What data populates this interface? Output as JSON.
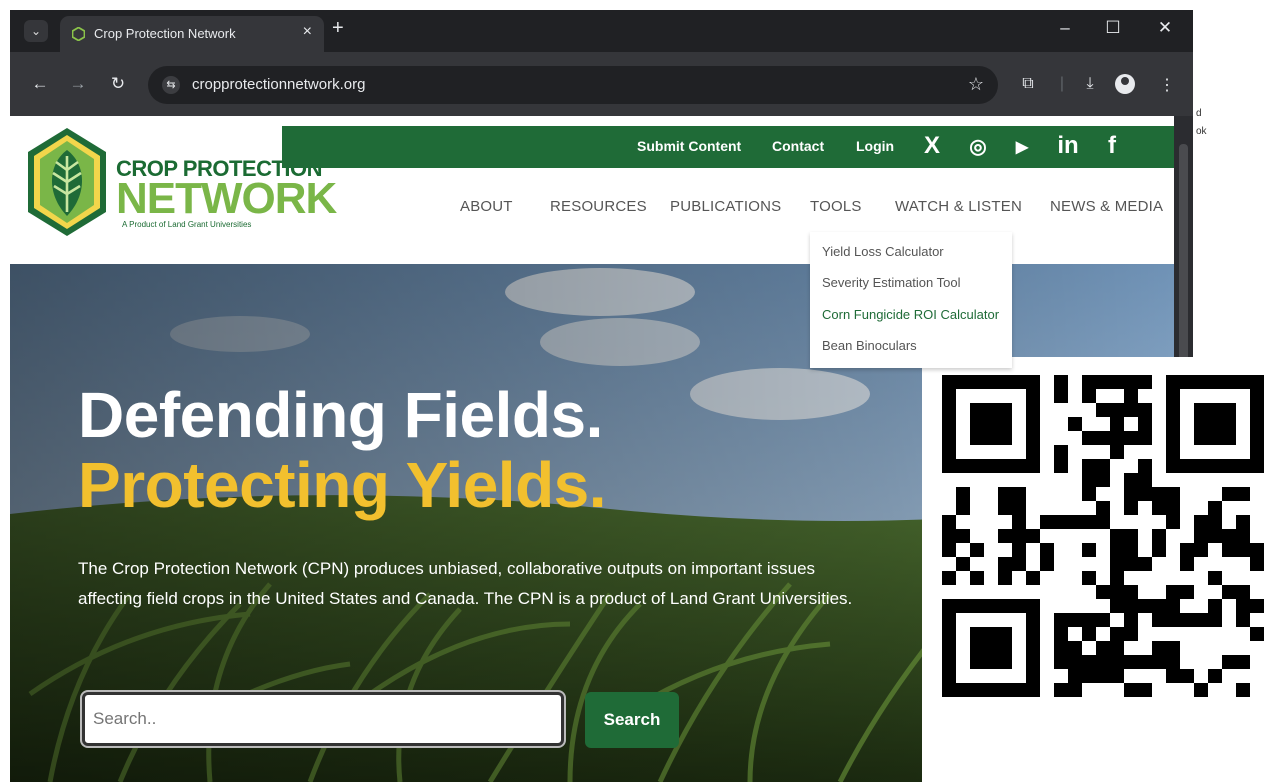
{
  "browser": {
    "tab_title": "Crop Protection Network",
    "url": "cropprotectionnetwork.org",
    "tab_close": "×",
    "new_tab": "+",
    "minimize": "–",
    "maximize": "☐",
    "close": "✕"
  },
  "site": {
    "brand_line1": "CROP PROTECTION",
    "brand_line2": "NETWORK",
    "brand_tagline": "A Product of Land Grant Universities",
    "top_links": [
      "Submit Content",
      "Contact",
      "Login"
    ],
    "social_icons": [
      "x-icon",
      "instagram-icon",
      "youtube-icon",
      "linkedin-icon",
      "facebook-icon"
    ],
    "social_glyphs": [
      "X",
      "◎",
      "▶",
      "in",
      "f"
    ],
    "menu": [
      "ABOUT",
      "RESOURCES",
      "PUBLICATIONS",
      "TOOLS",
      "WATCH & LISTEN",
      "NEWS & MEDIA"
    ],
    "tools_dropdown": [
      "Yield Loss Calculator",
      "Severity Estimation Tool",
      "Corn Fungicide ROI Calculator",
      "Bean Binoculars"
    ],
    "hero_line1": "Defending Fields.",
    "hero_line2": "Protecting Yields.",
    "hero_description": "The Crop Protection Network (CPN) produces unbiased, collaborative outputs on important issues affecting field crops in the United States and Canada. The CPN is a product of Land Grant Universities.",
    "search_placeholder": "Search..",
    "search_button": "Search"
  },
  "colors": {
    "brand_green": "#1f6b37",
    "light_green": "#7ab648",
    "hero_yellow": "#f2c02e"
  }
}
